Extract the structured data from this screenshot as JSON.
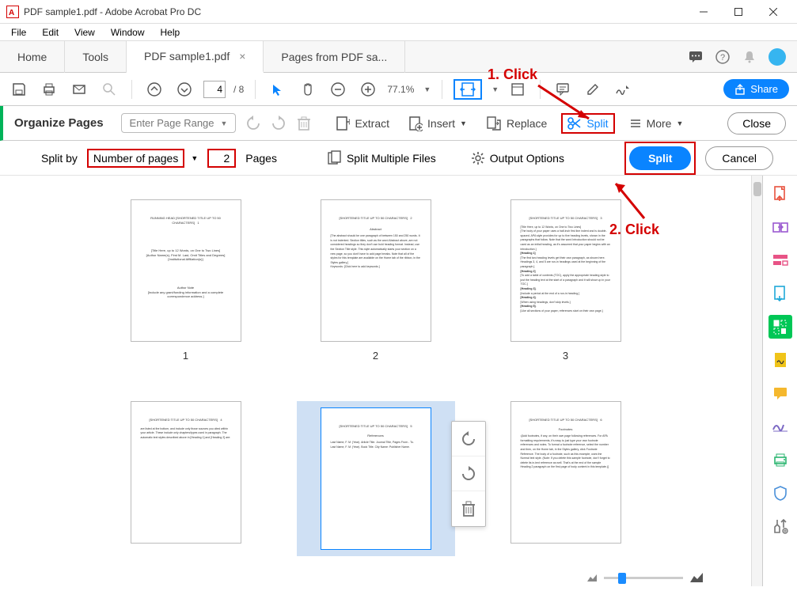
{
  "titlebar": {
    "title": "PDF sample1.pdf - Adobe Acrobat Pro DC"
  },
  "menu": {
    "file": "File",
    "edit": "Edit",
    "view": "View",
    "window": "Window",
    "help": "Help"
  },
  "tabs": {
    "home": "Home",
    "tools": "Tools",
    "active": "PDF sample1.pdf",
    "other": "Pages from PDF sa..."
  },
  "toolbar": {
    "page_current": "4",
    "page_total": "/ 8",
    "zoom": "77.1%",
    "share": "Share"
  },
  "orgbar": {
    "title": "Organize Pages",
    "range_placeholder": "Enter Page Range",
    "extract": "Extract",
    "insert": "Insert",
    "replace": "Replace",
    "split": "Split",
    "more": "More",
    "close": "Close"
  },
  "splitbar": {
    "label": "Split by",
    "method": "Number of pages",
    "value": "2",
    "pages": "Pages",
    "multi": "Split Multiple Files",
    "options": "Output Options",
    "split_btn": "Split",
    "cancel": "Cancel"
  },
  "pages": [
    "1",
    "2",
    "3"
  ],
  "annotations": {
    "click1": "1. Click",
    "click2": "2. Click"
  }
}
